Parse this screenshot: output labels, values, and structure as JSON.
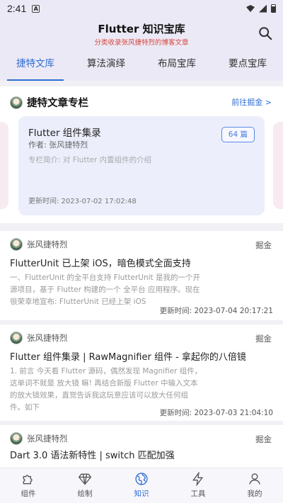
{
  "status_bar": {
    "time": "2:41"
  },
  "header": {
    "title": "Flutter 知识宝库",
    "subtitle": "分类收录张风捷特烈的博客文章"
  },
  "tabs": [
    {
      "label": "捷特文库",
      "active": true
    },
    {
      "label": "算法演绎",
      "active": false
    },
    {
      "label": "布局宝库",
      "active": false
    },
    {
      "label": "要点宝库",
      "active": false
    }
  ],
  "column": {
    "heading": "捷特文章专栏",
    "more_link": "前往掘金 >",
    "card": {
      "title": "Flutter 组件集录",
      "author": "作者: 张风捷特烈",
      "description": "专栏简介: 对 Flutter 内置组件的介绍",
      "count": "64 篇",
      "updated": "更新时间: 2023-07-02 17:02:48"
    }
  },
  "articles": [
    {
      "author": "张风捷特烈",
      "source": "掘金",
      "title": "FlutterUnit 已上架 iOS，暗色模式全面支持",
      "excerpt": "一、FlutterUnit 的全平台支持 FlutterUnit 是我的一个开源项目，基于 Flutter 构建的一个 全平台 应用程序。现在很荣幸地宣布: FlutterUnit 已经上架 iOS",
      "updated": "更新时间: 2023-07-04 20:17:21"
    },
    {
      "author": "张风捷特烈",
      "source": "掘金",
      "title": "Flutter 组件集录 | RawMagnifier 组件 - 拿起你的八倍镜",
      "excerpt": "1. 前言 今天看 Flutter 源码，偶然发现 Magnifier 组件，这单词不就是 放大镜 嘛! 再结合新版 Flutter 中输入文本的放大镜效果，直觉告诉我这玩意应该可以放大任何组件。如下",
      "updated": "更新时间: 2023-07-03 21:04:10"
    },
    {
      "author": "张风捷特烈",
      "source": "掘金",
      "title": "Dart 3.0 语法新特性 | switch 匹配加强"
    }
  ],
  "bottom_nav": [
    {
      "label": "组件",
      "icon": "puzzle-icon",
      "active": false
    },
    {
      "label": "绘制",
      "icon": "diamond-icon",
      "active": false
    },
    {
      "label": "知识",
      "icon": "globe-icon",
      "active": true
    },
    {
      "label": "工具",
      "icon": "lightning-icon",
      "active": false
    },
    {
      "label": "我的",
      "icon": "person-icon",
      "active": false
    }
  ],
  "colors": {
    "accent": "#2f6fd3",
    "subtitle": "#d6463c",
    "header_bg": "#ece9f6"
  }
}
